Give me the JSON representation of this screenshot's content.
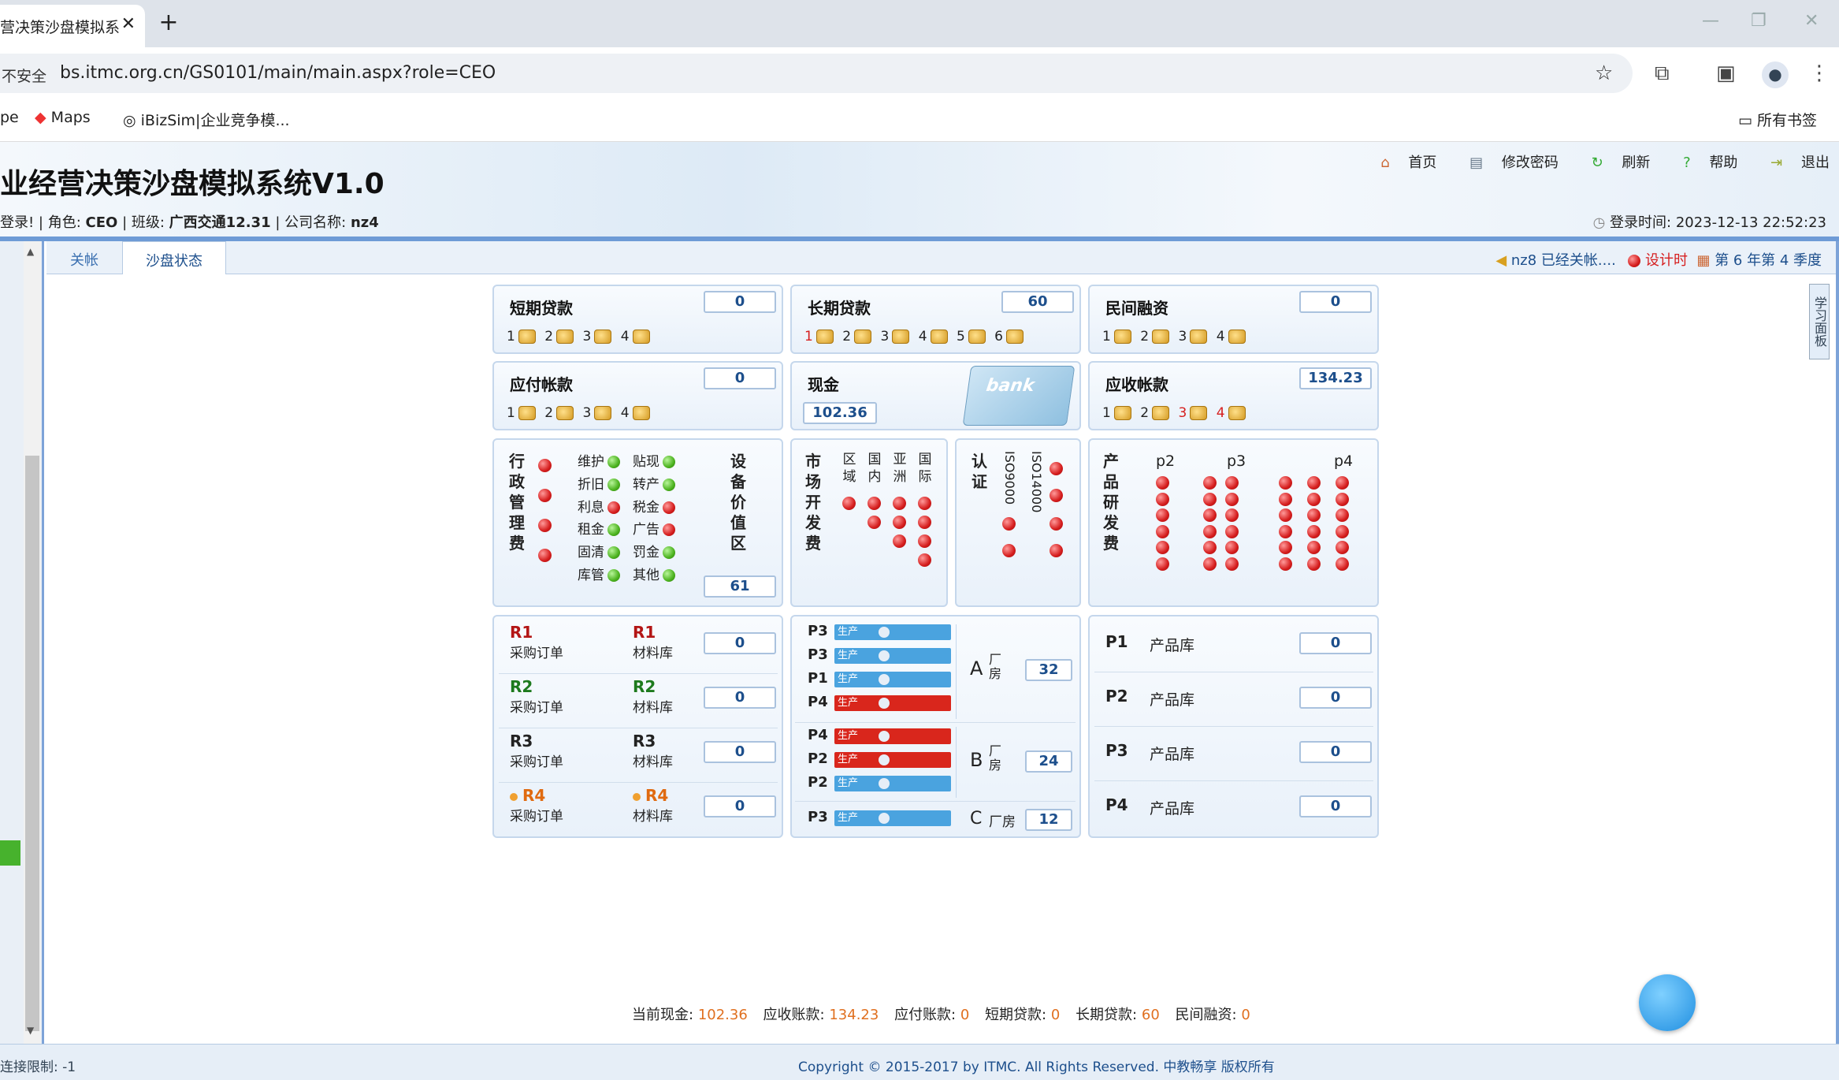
{
  "browser": {
    "tab_title": "营决策沙盘模拟系",
    "tab_close": "✕",
    "new_tab": "+",
    "security_label": "不安全",
    "url": "bs.itmc.org.cn/GS0101/main/main.aspx?role=CEO",
    "bookmarks": [
      "pe",
      "Maps",
      "iBizSim|企业竞争模..."
    ],
    "all_bookmarks": "所有书签"
  },
  "header": {
    "title": "业经营决策沙盘模拟系统V1.0",
    "info": {
      "login_prefix": "登录! | 角色:",
      "role": "CEO",
      "class_label": "| 班级:",
      "class_value": "广西交通12.31",
      "company_label": "| 公司名称:",
      "company_value": "nz4"
    },
    "nav": [
      "首页",
      "修改密码",
      "刷新",
      "帮助",
      "退出"
    ],
    "login_time_label": "登录时间:",
    "login_time": "2023-12-13 22:52:23"
  },
  "tabs": [
    "关帐",
    "沙盘状态"
  ],
  "status": {
    "notice": "nz8 已经关帐....",
    "design": "设计时",
    "period": "第 6 年第 4 季度"
  },
  "side_button": "学习面板",
  "finance": {
    "short_loan": {
      "title": "短期贷款",
      "value": "0",
      "slots": [
        "1",
        "2",
        "3",
        "4"
      ]
    },
    "long_loan": {
      "title": "长期贷款",
      "value": "60",
      "slots": [
        "1",
        "2",
        "3",
        "4",
        "5",
        "6"
      ]
    },
    "private_fin": {
      "title": "民间融资",
      "value": "0",
      "slots": [
        "1",
        "2",
        "3",
        "4"
      ]
    },
    "payable": {
      "title": "应付帐款",
      "value": "0",
      "slots": [
        "1",
        "2",
        "3",
        "4"
      ]
    },
    "cash": {
      "title": "现金",
      "value": "102.36",
      "bank_label": "bank"
    },
    "receivable": {
      "title": "应收帐款",
      "value": "134.23",
      "slots": [
        "1",
        "2",
        "3",
        "4"
      ]
    }
  },
  "admin": {
    "title": "行政管理费",
    "items_left": [
      "维护",
      "折旧",
      "利息",
      "租金",
      "固清",
      "库管"
    ],
    "items_right": [
      "贴现",
      "转产",
      "税金",
      "广告",
      "罚金",
      "其他"
    ],
    "left_status": [
      "green",
      "green",
      "red",
      "green",
      "green",
      "green"
    ],
    "right_status": [
      "green",
      "green",
      "red",
      "red",
      "green",
      "green"
    ],
    "equip_title": "设备价值区",
    "equip_value": "61"
  },
  "market": {
    "title": "市场开发费",
    "columns": [
      "区域",
      "国内",
      "亚洲",
      "国际"
    ]
  },
  "cert": {
    "title": "认证",
    "columns": [
      "ISO9000",
      "ISO14000"
    ]
  },
  "rnd": {
    "title": "产品研发费",
    "columns": [
      "p2",
      "p3",
      "p4"
    ]
  },
  "materials": [
    {
      "code": "R1",
      "order": "采购订单",
      "store": "材料库",
      "value": "0",
      "color": "#b31515"
    },
    {
      "code": "R2",
      "order": "采购订单",
      "store": "材料库",
      "value": "0",
      "color": "#1d7a1d"
    },
    {
      "code": "R3",
      "order": "采购订单",
      "store": "材料库",
      "value": "0",
      "color": "#222222"
    },
    {
      "code": "R4",
      "order": "采购订单",
      "store": "材料库",
      "value": "0",
      "color": "#e06a10"
    }
  ],
  "production": {
    "bar_label": "生产",
    "lines_a": [
      {
        "p": "P3",
        "c": "blue"
      },
      {
        "p": "P3",
        "c": "blue"
      },
      {
        "p": "P1",
        "c": "blue"
      },
      {
        "p": "P4",
        "c": "red"
      }
    ],
    "lines_b": [
      {
        "p": "P4",
        "c": "red"
      },
      {
        "p": "P2",
        "c": "red"
      },
      {
        "p": "P2",
        "c": "blue"
      }
    ],
    "lines_c": [
      {
        "p": "P3",
        "c": "blue"
      }
    ],
    "plant_a": {
      "letter": "A",
      "label": "厂房",
      "value": "32"
    },
    "plant_b": {
      "letter": "B",
      "label": "厂房",
      "value": "24"
    },
    "plant_c": {
      "letter": "C",
      "label": "厂房",
      "value": "12"
    }
  },
  "products": [
    {
      "code": "P1",
      "label": "产品库",
      "value": "0"
    },
    {
      "code": "P2",
      "label": "产品库",
      "value": "0"
    },
    {
      "code": "P3",
      "label": "产品库",
      "value": "0"
    },
    {
      "code": "P4",
      "label": "产品库",
      "value": "0"
    }
  ],
  "summary": {
    "cash_label": "当前现金:",
    "cash": "102.36",
    "recv_label": "应收账款:",
    "recv": "134.23",
    "pay_label": "应付账款:",
    "pay": "0",
    "short_label": "短期贷款:",
    "short": "0",
    "long_label": "长期贷款:",
    "long": "60",
    "private_label": "民间融资:",
    "private": "0"
  },
  "footer": {
    "left": "连接限制: -1",
    "copyright": "Copyright © 2015-2017 by ITMC. All Rights Reserved. 中教畅享 版权所有"
  }
}
